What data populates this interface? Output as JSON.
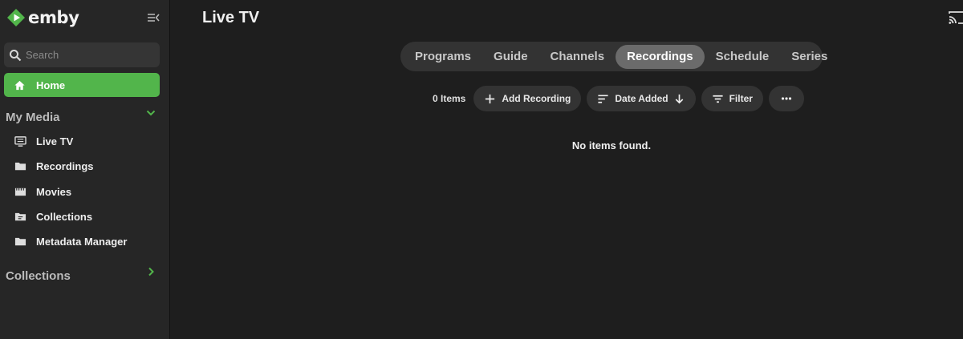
{
  "brand": {
    "name": "emby",
    "accent": "#52b54b"
  },
  "sidebar": {
    "search_placeholder": "Search",
    "home_label": "Home",
    "sections": [
      {
        "title": "My Media",
        "expanded": true
      },
      {
        "title": "Collections",
        "expanded": false
      }
    ],
    "items": [
      {
        "label": "Live TV",
        "icon": "live-tv-icon"
      },
      {
        "label": "Recordings",
        "icon": "folder-icon"
      },
      {
        "label": "Movies",
        "icon": "movie-icon"
      },
      {
        "label": "Collections",
        "icon": "collection-folder-icon"
      },
      {
        "label": "Metadata Manager",
        "icon": "folder-icon"
      }
    ]
  },
  "header": {
    "title": "Live TV"
  },
  "tabs": [
    {
      "label": "Programs",
      "active": false
    },
    {
      "label": "Guide",
      "active": false
    },
    {
      "label": "Channels",
      "active": false
    },
    {
      "label": "Recordings",
      "active": true
    },
    {
      "label": "Schedule",
      "active": false
    },
    {
      "label": "Series",
      "active": false
    }
  ],
  "toolbar": {
    "count": "0 Items",
    "add_label": "Add Recording",
    "sort_label": "Date Added",
    "filter_label": "Filter"
  },
  "main": {
    "empty_message": "No items found."
  }
}
